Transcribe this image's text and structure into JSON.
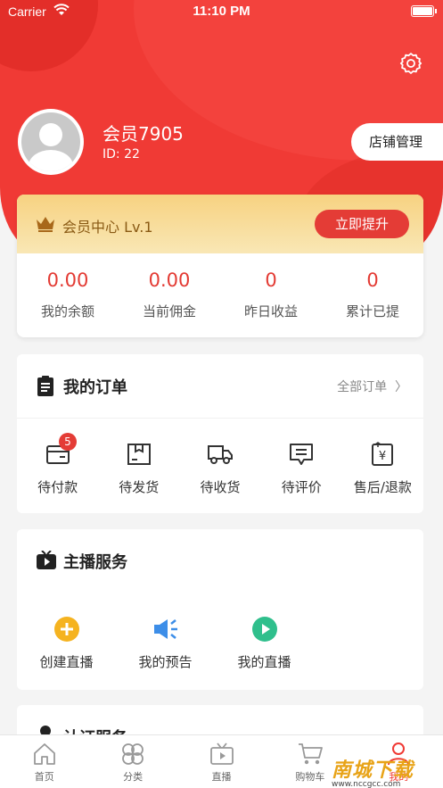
{
  "status": {
    "carrier": "Carrier",
    "time": "11:10 PM"
  },
  "profile": {
    "name": "会员7905",
    "id": "ID: 22",
    "store_button": "店铺管理"
  },
  "member": {
    "level_text": "会员中心 Lv.1",
    "upgrade_button": "立即提升",
    "stats": [
      {
        "value": "0.00",
        "label": "我的余额"
      },
      {
        "value": "0.00",
        "label": "当前佣金"
      },
      {
        "value": "0",
        "label": "昨日收益"
      },
      {
        "value": "0",
        "label": "累计已提"
      }
    ]
  },
  "orders": {
    "title": "我的订单",
    "view_all": "全部订单",
    "items": [
      {
        "label": "待付款",
        "icon": "wallet-icon",
        "badge": "5"
      },
      {
        "label": "待发货",
        "icon": "package-icon"
      },
      {
        "label": "待收货",
        "icon": "truck-icon"
      },
      {
        "label": "待评价",
        "icon": "comment-icon"
      },
      {
        "label": "售后/退款",
        "icon": "refund-icon"
      }
    ]
  },
  "streamer": {
    "title": "主播服务",
    "items": [
      {
        "label": "创建直播",
        "icon": "plus-circle-icon",
        "color": "#f5b320"
      },
      {
        "label": "我的预告",
        "icon": "speaker-icon",
        "color": "#3d8ee8"
      },
      {
        "label": "我的直播",
        "icon": "play-circle-icon",
        "color": "#2fbf8c"
      }
    ]
  },
  "certification": {
    "title": "认证服务"
  },
  "tabs": [
    {
      "label": "首页",
      "icon": "home-icon"
    },
    {
      "label": "分类",
      "icon": "category-icon"
    },
    {
      "label": "直播",
      "icon": "tv-icon"
    },
    {
      "label": "购物车",
      "icon": "cart-icon"
    },
    {
      "label": "我的",
      "icon": "user-icon"
    }
  ],
  "watermark": {
    "brand": "南城下载",
    "url": "www.nccgcc.com"
  },
  "colors": {
    "primary": "#f03a35",
    "gold": "#f7d281",
    "accent_red": "#e43c36"
  }
}
